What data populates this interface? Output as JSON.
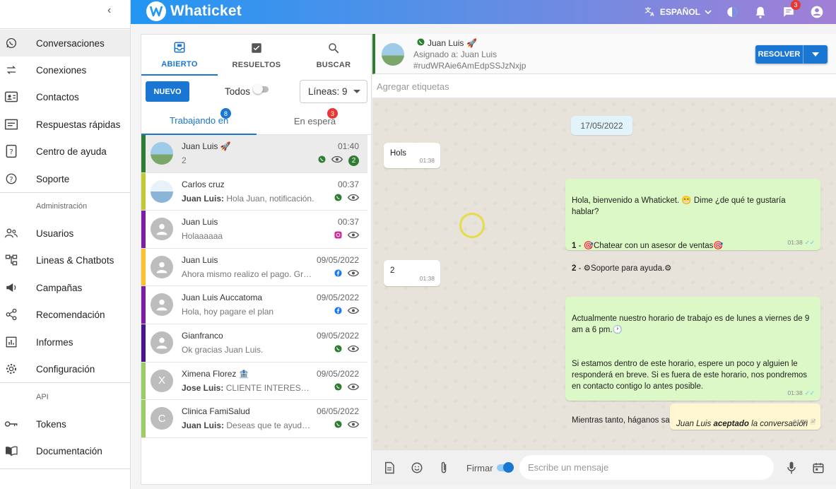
{
  "app": {
    "brand": "Whaticket",
    "language": "ESPAÑOL",
    "notification_count": "3",
    "accent": "#1976d2",
    "header_gradient": [
      "#2196f3",
      "#a27fd6"
    ]
  },
  "sidebar": {
    "items": [
      {
        "label": "Conversaciones",
        "icon": "whatsapp-icon"
      },
      {
        "label": "Conexiones",
        "icon": "sync-arrows-icon"
      },
      {
        "label": "Contactos",
        "icon": "contact-card-icon"
      },
      {
        "label": "Respuestas rápidas",
        "icon": "quick-reply-icon"
      },
      {
        "label": "Centro de ayuda",
        "icon": "help-center-icon"
      },
      {
        "label": "Soporte",
        "icon": "question-icon"
      }
    ],
    "admin_heading": "Administración",
    "admin_items": [
      {
        "label": "Usuarios",
        "icon": "users-icon"
      },
      {
        "label": "Lineas & Chatbots",
        "icon": "tree-icon"
      },
      {
        "label": "Campañas",
        "icon": "megaphone-icon"
      },
      {
        "label": "Recomendación",
        "icon": "share-icon"
      },
      {
        "label": "Informes",
        "icon": "chart-icon"
      },
      {
        "label": "Configuración",
        "icon": "gear-icon"
      }
    ],
    "api_heading": "API",
    "api_items": [
      {
        "label": "Tokens",
        "icon": "key-icon"
      },
      {
        "label": "Documentación",
        "icon": "book-icon"
      }
    ]
  },
  "tickets_panel": {
    "tabs": [
      {
        "label": "ABIERTO",
        "icon": "inbox-icon"
      },
      {
        "label": "RESUELTOS",
        "icon": "check-box-icon"
      },
      {
        "label": "BUSCAR",
        "icon": "search-icon"
      }
    ],
    "new_button": "NUEVO",
    "todos_label": "Todos",
    "lines_select": "Líneas: 9",
    "subtabs": [
      {
        "label": "Trabajando en",
        "badge": "8",
        "badge_color": "#1976d2"
      },
      {
        "label": "En espera",
        "badge": "3",
        "badge_color": "#e53935"
      }
    ],
    "tickets": [
      {
        "name": "Juan Luis",
        "emoji": "🚀",
        "time": "01:40",
        "sender": "",
        "message": "2",
        "channel": "whatsapp",
        "unread": "2",
        "color": "#2e7d32",
        "avatar": "photo"
      },
      {
        "name": "Carlos cruz",
        "emoji": "",
        "time": "00:37",
        "sender": "Juan Luis:",
        "message": "Hola Juan, notificación.",
        "channel": "whatsapp",
        "unread": "",
        "color": "#c0ca33",
        "avatar": "photo"
      },
      {
        "name": "Juan Luis",
        "emoji": "",
        "time": "00:37",
        "sender": "",
        "message": "Holaaaaaa",
        "channel": "instagram",
        "unread": "",
        "color": "#7b1fa2",
        "avatar": ""
      },
      {
        "name": "Juan Luis",
        "emoji": "",
        "time": "09/05/2022",
        "sender": "",
        "message": "Ahora mismo realizo el pago. Gracias",
        "channel": "facebook",
        "unread": "",
        "color": "#fbc02d",
        "avatar": ""
      },
      {
        "name": "Juan Luis Auccatoma",
        "emoji": "",
        "time": "09/05/2022",
        "sender": "",
        "message": "Hola, hoy pagare el plan",
        "channel": "facebook",
        "unread": "",
        "color": "#7b1fa2",
        "avatar": ""
      },
      {
        "name": "Gianfranco",
        "emoji": "",
        "time": "09/05/2022",
        "sender": "",
        "message": "Ok gracias Juan Luis.",
        "channel": "whatsapp",
        "unread": "",
        "color": "#4a148c",
        "avatar": ""
      },
      {
        "name": "Ximena Florez",
        "emoji": "🏦",
        "time": "09/05/2022",
        "sender": "Jose Luis:",
        "message": "CLIENTE INTERESADO, P...",
        "channel": "whatsapp",
        "unread": "",
        "color": "#9ccc65",
        "avatar": "X"
      },
      {
        "name": "Clinica FamiSalud",
        "emoji": "",
        "time": "06/05/2022",
        "sender": "Juan Luis:",
        "message": "Deseas que te ayude con ...",
        "channel": "whatsapp",
        "unread": "",
        "color": "#9ccc65",
        "avatar": "C"
      }
    ]
  },
  "chat": {
    "contact_name": "Juan Luis",
    "contact_emoji": "🚀",
    "assigned": "Asignado a: Juan Luis",
    "ticket_id": "#rudWRAie6AmEdpSSJzNxjp",
    "resolve_button": "RESOLVER",
    "tags_placeholder": "Agregar etiquetas",
    "date_chip": "17/05/2022",
    "messages": [
      {
        "dir": "in",
        "text": "Hols",
        "time": "01:38"
      },
      {
        "dir": "out",
        "text": "Hola, bienvenido a Whaticket. 😁 Dime ¿de qué te gustaría hablar?",
        "time": "01:38"
      },
      {
        "dir": "in",
        "text": "2",
        "time": "01:38"
      },
      {
        "dir": "out",
        "text": "Actualmente nuestro horario de trabajo es de lunes a viernes de 9 am a 6 pm.🕐",
        "time": "01:38"
      }
    ],
    "menu_option_1": "- 🎯Chatear con un asesor de ventas🎯",
    "menu_option_2": "- ⚙Soporte para ayuda.⚙",
    "schedule_p2": "Si estamos dentro de este horario, espere un poco y alguien le responderá en breve. Si es fuera de este horario, nos pondremos en contacto contigo lo antes posible.",
    "schedule_p3": "Mientras tanto, háganos saber cómo podemos ayudarlo.😍🛠",
    "note": {
      "name": "Juan Luis",
      "action": "aceptado",
      "rest": "la conversación",
      "time": "01:40"
    },
    "composer": {
      "sign_label": "Firmar",
      "placeholder": "Escribe un mensaje"
    }
  }
}
